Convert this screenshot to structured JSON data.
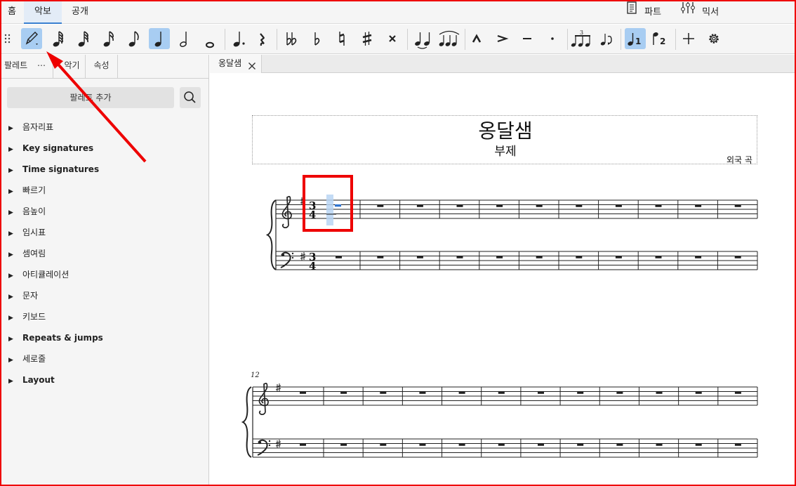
{
  "menu": {
    "tabs": [
      "홈",
      "악보",
      "공개"
    ],
    "active_tab": "악보",
    "parts_label": "파트",
    "mixer_label": "믹서"
  },
  "toolbar": {
    "buttons": [
      {
        "name": "note-input-pencil-icon",
        "active": true
      },
      {
        "name": "64th-note-icon",
        "active": false
      },
      {
        "name": "32nd-note-icon",
        "active": false
      },
      {
        "name": "16th-note-icon",
        "active": false
      },
      {
        "name": "eighth-note-icon",
        "active": false
      },
      {
        "name": "quarter-note-icon",
        "active": true
      },
      {
        "name": "half-note-icon",
        "active": false
      },
      {
        "name": "whole-note-icon",
        "active": false
      },
      {
        "name": "augmentation-dot-icon",
        "active": false
      },
      {
        "name": "rest-icon",
        "active": false
      },
      {
        "name": "double-flat-icon",
        "active": false
      },
      {
        "name": "flat-icon",
        "active": false
      },
      {
        "name": "natural-icon",
        "active": false
      },
      {
        "name": "sharp-icon",
        "active": false
      },
      {
        "name": "double-sharp-icon",
        "active": false
      },
      {
        "name": "tie-icon",
        "active": false
      },
      {
        "name": "slur-icon",
        "active": false
      },
      {
        "name": "marcato-icon",
        "active": false
      },
      {
        "name": "accent-icon",
        "active": false
      },
      {
        "name": "tenuto-icon",
        "active": false
      },
      {
        "name": "staccato-icon",
        "active": false
      },
      {
        "name": "tuplet-icon",
        "active": false
      },
      {
        "name": "flip-direction-icon",
        "active": false
      },
      {
        "name": "voice-1-icon",
        "active": true
      },
      {
        "name": "voice-2-icon",
        "active": false
      },
      {
        "name": "add-icon",
        "active": false
      },
      {
        "name": "settings-gear-icon",
        "active": false
      }
    ],
    "voice1_digit": "1",
    "voice2_digit": "2",
    "tuplet_digit": "3"
  },
  "left_panel": {
    "tabs": [
      "팔레트",
      "악기",
      "속성"
    ],
    "more_label": "⋯",
    "add_palette_label": "팔레트 추가",
    "items": [
      {
        "label": "음자리표",
        "bold": false
      },
      {
        "label": "Key signatures",
        "bold": true
      },
      {
        "label": "Time signatures",
        "bold": true
      },
      {
        "label": "빠르기",
        "bold": false
      },
      {
        "label": "음높이",
        "bold": false
      },
      {
        "label": "임시표",
        "bold": false
      },
      {
        "label": "셈여림",
        "bold": false
      },
      {
        "label": "아티큘레이션",
        "bold": false
      },
      {
        "label": "문자",
        "bold": false
      },
      {
        "label": "키보드",
        "bold": false
      },
      {
        "label": "Repeats & jumps",
        "bold": true
      },
      {
        "label": "세로줄",
        "bold": false
      },
      {
        "label": "Layout",
        "bold": true
      }
    ]
  },
  "score": {
    "tab_label": "옹달샘",
    "title": "옹달샘",
    "subtitle": "부제",
    "composer": "외국 곡",
    "time_sig_top": "3",
    "time_sig_bottom": "4",
    "system2_measure_number": "12",
    "system1_measures": 11,
    "system2_measures": 12
  }
}
